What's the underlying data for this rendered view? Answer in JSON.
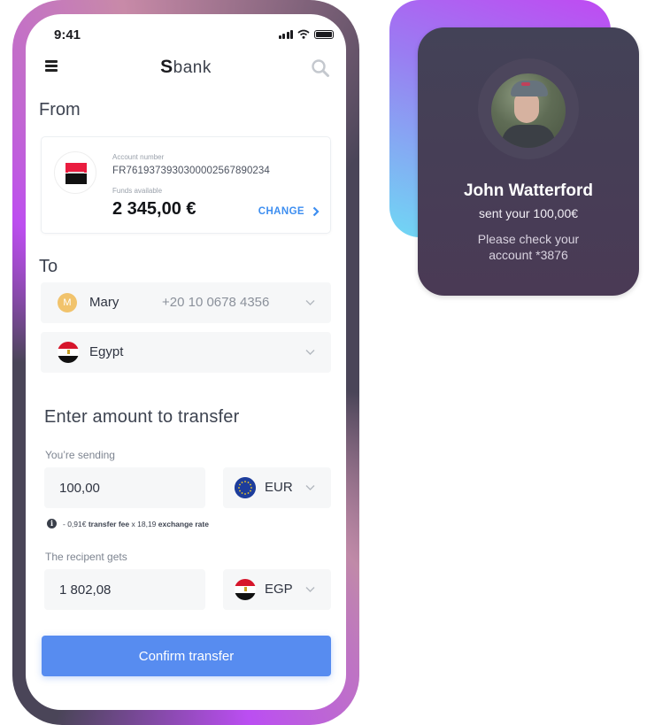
{
  "status_bar": {
    "time": "9:41"
  },
  "nav": {
    "logo_mark": "S",
    "logo_text": "bank"
  },
  "from": {
    "title": "From",
    "account_number_label": "Account number",
    "account_number": "FR7619373930300002567890234",
    "funds_label": "Funds available",
    "funds": "2 345,00 €",
    "change_label": "CHANGE"
  },
  "to": {
    "title": "To",
    "recipient": {
      "initial": "M",
      "name": "Mary",
      "phone": "+20 10 0678 4356"
    },
    "country": {
      "name": "Egypt"
    }
  },
  "amount": {
    "title": "Enter amount to transfer",
    "sending_label": "You’re sending",
    "sending_value": "100,00",
    "sending_currency": "EUR",
    "fee_prefix": "- 0,91€",
    "fee_label": "transfer fee",
    "fee_mid": "x 18,19",
    "rate_label": "exchange rate",
    "receiving_label": "The recipent gets",
    "receiving_value": "1 802,08",
    "receiving_currency": "EGP"
  },
  "confirm_label": "Confirm transfer",
  "notification": {
    "name": "John Watterford",
    "sent": "sent your 100,00€",
    "message_line1": "Please check your",
    "message_line2": "account *3876"
  },
  "colors": {
    "accent": "#578cf0",
    "link": "#3d8ef0",
    "card_dark": "#434257",
    "gradient_purple": "#c04af2",
    "gradient_cyan": "#6fd8f4"
  }
}
